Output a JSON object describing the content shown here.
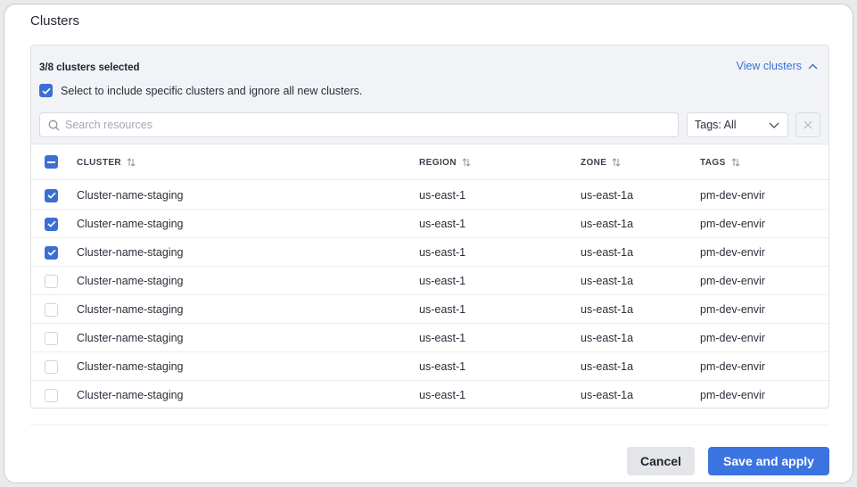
{
  "dialog": {
    "title": "Clusters"
  },
  "selection": {
    "count_text": "3/8 clusters selected",
    "view_link": "View clusters",
    "include_text": "Select to include specific clusters and ignore all new clusters.",
    "include_checked": true
  },
  "search": {
    "placeholder": "Search resources",
    "value": ""
  },
  "tags_filter": {
    "label": "Tags: All"
  },
  "table": {
    "columns": [
      "CLUSTER",
      "REGION",
      "ZONE",
      "TAGS"
    ],
    "header_checkbox_state": "indeterminate",
    "rows": [
      {
        "checked": true,
        "cluster": "Cluster-name-staging",
        "region": "us-east-1",
        "zone": "us-east-1a",
        "tags": "pm-dev-envir"
      },
      {
        "checked": true,
        "cluster": "Cluster-name-staging",
        "region": "us-east-1",
        "zone": "us-east-1a",
        "tags": "pm-dev-envir"
      },
      {
        "checked": true,
        "cluster": "Cluster-name-staging",
        "region": "us-east-1",
        "zone": "us-east-1a",
        "tags": "pm-dev-envir"
      },
      {
        "checked": false,
        "cluster": "Cluster-name-staging",
        "region": "us-east-1",
        "zone": "us-east-1a",
        "tags": "pm-dev-envir"
      },
      {
        "checked": false,
        "cluster": "Cluster-name-staging",
        "region": "us-east-1",
        "zone": "us-east-1a",
        "tags": "pm-dev-envir"
      },
      {
        "checked": false,
        "cluster": "Cluster-name-staging",
        "region": "us-east-1",
        "zone": "us-east-1a",
        "tags": "pm-dev-envir"
      },
      {
        "checked": false,
        "cluster": "Cluster-name-staging",
        "region": "us-east-1",
        "zone": "us-east-1a",
        "tags": "pm-dev-envir"
      },
      {
        "checked": false,
        "cluster": "Cluster-name-staging",
        "region": "us-east-1",
        "zone": "us-east-1a",
        "tags": "pm-dev-envir"
      }
    ]
  },
  "footer": {
    "cancel_label": "Cancel",
    "save_label": "Save and apply"
  },
  "colors": {
    "accent": "#3b6fd4",
    "primary_button": "#3b73e0",
    "panel_header_bg": "#f1f3f7"
  },
  "icons": {
    "view_link": "chevron-up-icon",
    "search": "search-icon",
    "tags_filter": "chevron-down-icon",
    "clear": "close-icon",
    "sort": "sort-icon",
    "checkbox_checked": "check-icon",
    "checkbox_header": "minus-icon"
  }
}
